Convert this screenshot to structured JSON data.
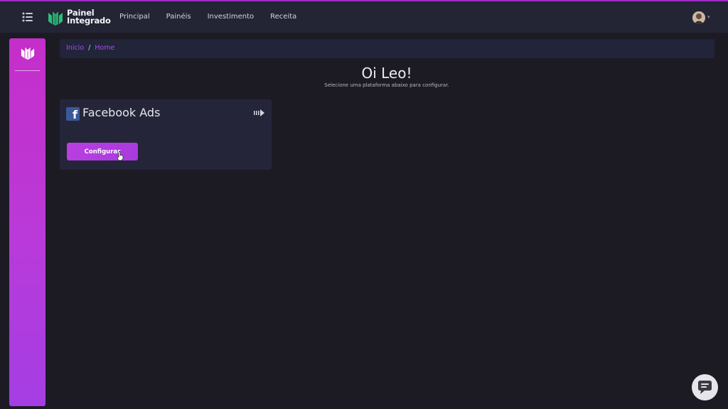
{
  "header": {
    "menu_icon": "list-menu-icon",
    "logo": {
      "line1": "Painel",
      "line2": "Integrado"
    },
    "nav": [
      "Principal",
      "Painéis",
      "Investimento",
      "Receita"
    ]
  },
  "sidebar": {
    "logo_icon": "brand-logo-icon"
  },
  "breadcrumb": {
    "home": "Inicio",
    "separator": "/",
    "current": "Home"
  },
  "main": {
    "greeting": "Oi Leo!",
    "subtitle": "Selecione uma plataforma abaixo para configurar."
  },
  "card": {
    "icon": "facebook-icon",
    "icon_glyph": "f",
    "title": "Facebook Ads",
    "button_label": "Configurar"
  },
  "colors": {
    "accent": "#b83fe0",
    "sidebar_top": "#c52ec9",
    "sidebar_bottom": "#a43ee4",
    "background": "#1c1b24",
    "facebook_blue": "#3b5998"
  }
}
